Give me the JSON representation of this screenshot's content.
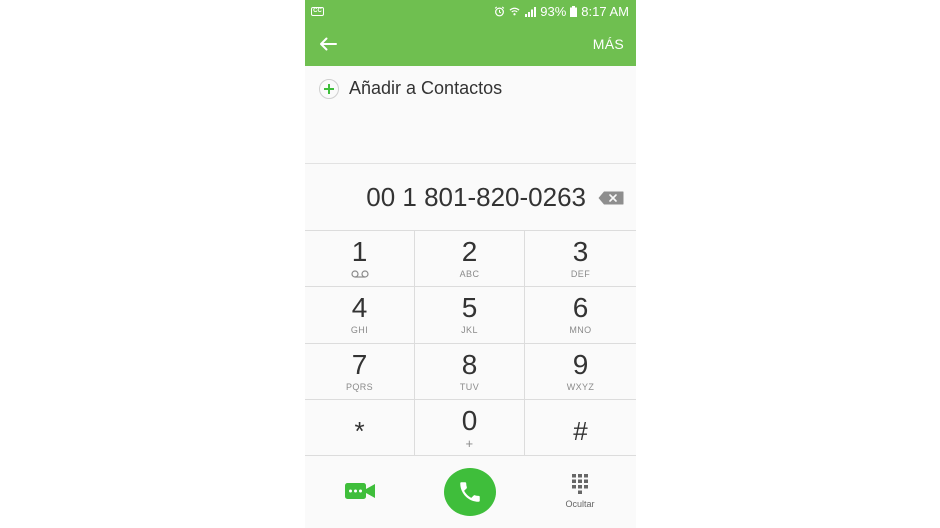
{
  "colors": {
    "accent": "#6fbf50",
    "call": "#3fbe3b"
  },
  "status_bar": {
    "battery": "93%",
    "time": "8:17 AM",
    "notification_badge": "CC"
  },
  "app_bar": {
    "more_label": "MÁS",
    "back_icon": "arrow-left-icon"
  },
  "add_contact": {
    "label": "Añadir a Contactos"
  },
  "dialer": {
    "number": "00 1 801-820-0263"
  },
  "keypad": {
    "keys": [
      {
        "digit": "1",
        "letters": ""
      },
      {
        "digit": "2",
        "letters": "ABC"
      },
      {
        "digit": "3",
        "letters": "DEF"
      },
      {
        "digit": "4",
        "letters": "GHI"
      },
      {
        "digit": "5",
        "letters": "JKL"
      },
      {
        "digit": "6",
        "letters": "MNO"
      },
      {
        "digit": "7",
        "letters": "PQRS"
      },
      {
        "digit": "8",
        "letters": "TUV"
      },
      {
        "digit": "9",
        "letters": "WXYZ"
      },
      {
        "digit": "*",
        "letters": ""
      },
      {
        "digit": "0",
        "letters": "+"
      },
      {
        "digit": "#",
        "letters": ""
      }
    ]
  },
  "bottom_bar": {
    "hide_label": "Ocultar"
  }
}
